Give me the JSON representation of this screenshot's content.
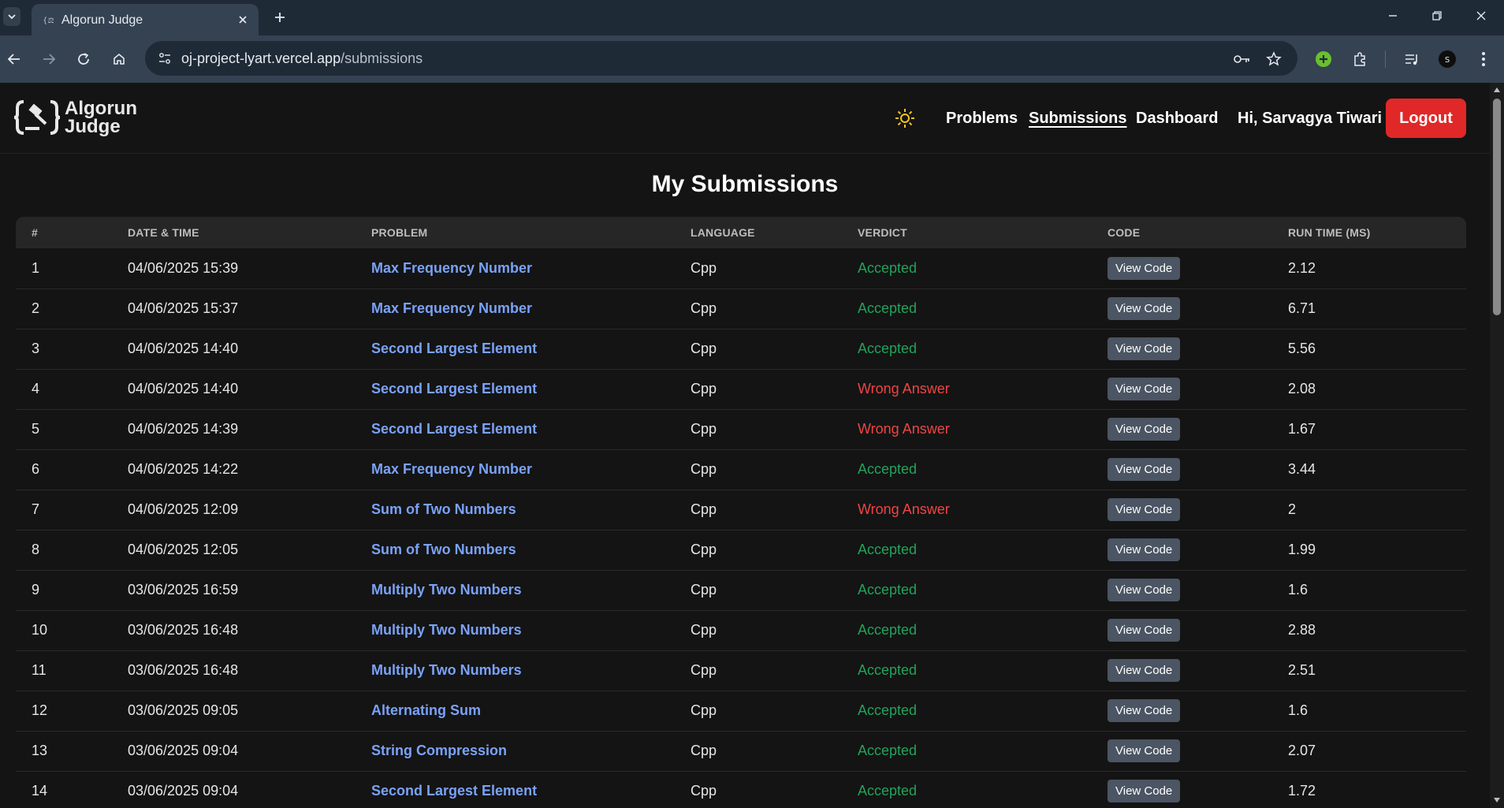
{
  "browser": {
    "tab_title": "Algorun Judge",
    "url_host": "oj-project-lyart.vercel.app",
    "url_path": "/submissions",
    "profile_initial": "S"
  },
  "site": {
    "logo_line1": "Algorun",
    "logo_line2": "Judge",
    "nav": {
      "problems": "Problems",
      "submissions": "Submissions",
      "dashboard": "Dashboard"
    },
    "greeting": "Hi, Sarvagya Tiwari",
    "logout_label": "Logout"
  },
  "page_title": "My Submissions",
  "table": {
    "headers": [
      "#",
      "DATE & TIME",
      "PROBLEM",
      "LANGUAGE",
      "VERDICT",
      "CODE",
      "RUN TIME (MS)"
    ],
    "view_code_label": "View Code",
    "rows": [
      {
        "num": "1",
        "datetime": "04/06/2025 15:39",
        "problem": "Max Frequency Number",
        "language": "Cpp",
        "verdict": "Accepted",
        "runtime": "2.12"
      },
      {
        "num": "2",
        "datetime": "04/06/2025 15:37",
        "problem": "Max Frequency Number",
        "language": "Cpp",
        "verdict": "Accepted",
        "runtime": "6.71"
      },
      {
        "num": "3",
        "datetime": "04/06/2025 14:40",
        "problem": "Second Largest Element",
        "language": "Cpp",
        "verdict": "Accepted",
        "runtime": "5.56"
      },
      {
        "num": "4",
        "datetime": "04/06/2025 14:40",
        "problem": "Second Largest Element",
        "language": "Cpp",
        "verdict": "Wrong Answer",
        "runtime": "2.08"
      },
      {
        "num": "5",
        "datetime": "04/06/2025 14:39",
        "problem": "Second Largest Element",
        "language": "Cpp",
        "verdict": "Wrong Answer",
        "runtime": "1.67"
      },
      {
        "num": "6",
        "datetime": "04/06/2025 14:22",
        "problem": "Max Frequency Number",
        "language": "Cpp",
        "verdict": "Accepted",
        "runtime": "3.44"
      },
      {
        "num": "7",
        "datetime": "04/06/2025 12:09",
        "problem": "Sum of Two Numbers",
        "language": "Cpp",
        "verdict": "Wrong Answer",
        "runtime": "2"
      },
      {
        "num": "8",
        "datetime": "04/06/2025 12:05",
        "problem": "Sum of Two Numbers",
        "language": "Cpp",
        "verdict": "Accepted",
        "runtime": "1.99"
      },
      {
        "num": "9",
        "datetime": "03/06/2025 16:59",
        "problem": "Multiply Two Numbers",
        "language": "Cpp",
        "verdict": "Accepted",
        "runtime": "1.6"
      },
      {
        "num": "10",
        "datetime": "03/06/2025 16:48",
        "problem": "Multiply Two Numbers",
        "language": "Cpp",
        "verdict": "Accepted",
        "runtime": "2.88"
      },
      {
        "num": "11",
        "datetime": "03/06/2025 16:48",
        "problem": "Multiply Two Numbers",
        "language": "Cpp",
        "verdict": "Accepted",
        "runtime": "2.51"
      },
      {
        "num": "12",
        "datetime": "03/06/2025 09:05",
        "problem": "Alternating Sum",
        "language": "Cpp",
        "verdict": "Accepted",
        "runtime": "1.6"
      },
      {
        "num": "13",
        "datetime": "03/06/2025 09:04",
        "problem": "String Compression",
        "language": "Cpp",
        "verdict": "Accepted",
        "runtime": "2.07"
      },
      {
        "num": "14",
        "datetime": "03/06/2025 09:04",
        "problem": "Second Largest Element",
        "language": "Cpp",
        "verdict": "Accepted",
        "runtime": "1.72"
      }
    ]
  },
  "colors": {
    "accepted": "#22a35a",
    "wrong_answer": "#ef4444",
    "problem_link": "#7aa2f7",
    "logout_bg": "#e02828"
  },
  "icons": {
    "theme_toggle": "sun-icon",
    "logo": "gavel-brackets-icon"
  }
}
